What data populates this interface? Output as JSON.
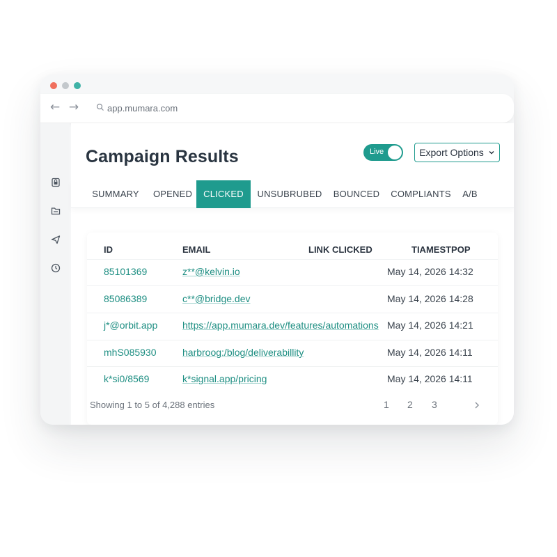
{
  "window": {
    "dot_colors": [
      "#f0705e",
      "#c3c8cc",
      "#3fb2a6"
    ]
  },
  "browser": {
    "back_icon": "arrow-left-icon",
    "forward_icon": "arrow-right-icon",
    "url": "app.mumara.com"
  },
  "sidebar": {
    "icons": [
      "lock-file-icon",
      "folder-icon",
      "send-icon",
      "clock-icon"
    ]
  },
  "header": {
    "title": "Campaign Results",
    "live_label": "Live",
    "export_label": "Export Options"
  },
  "tabs": [
    {
      "label": "SUMMARY",
      "active": false
    },
    {
      "label": "OPENED",
      "active": false
    },
    {
      "label": "CLICKED",
      "active": true
    },
    {
      "label": "UNSUBRUBED",
      "active": false
    },
    {
      "label": "BOUNCED",
      "active": false
    },
    {
      "label": "COMPLIANTS",
      "active": false
    },
    {
      "label": "A/B",
      "active": false
    }
  ],
  "table": {
    "headers": [
      "ID",
      "EMAIL",
      "LINK CLICKED",
      "TIAMESTPOP"
    ],
    "rows": [
      {
        "id": "85101369",
        "email": "z**@kelvin.io",
        "link": "",
        "timestamp": "May 14, 2026 14:32"
      },
      {
        "id": "85086389",
        "email": "c**@bridge.dev",
        "link": "",
        "timestamp": "May 14, 2026 14:28"
      },
      {
        "id": "j*@orbit.app",
        "email": "https://app.mumara.dev/features/automations",
        "link": "",
        "timestamp": "May 14, 2026 14:21"
      },
      {
        "id": "mhS085930",
        "email": "harbroog:/blog/deliverabillity",
        "link": "",
        "timestamp": "May 14, 2026 14:11"
      },
      {
        "id": "k*si0/8569",
        "email": "k*signal.app/pricing",
        "link": "",
        "timestamp": "May 14, 2026 14:11"
      }
    ]
  },
  "footer": {
    "entries_text": "Showing 1 to 5 of 4,288 entries",
    "pages": [
      "1",
      "2",
      "3"
    ],
    "next_icon": "chevron-right-icon"
  },
  "colors": {
    "accent": "#1f9b8e",
    "link": "#1d8e82"
  }
}
